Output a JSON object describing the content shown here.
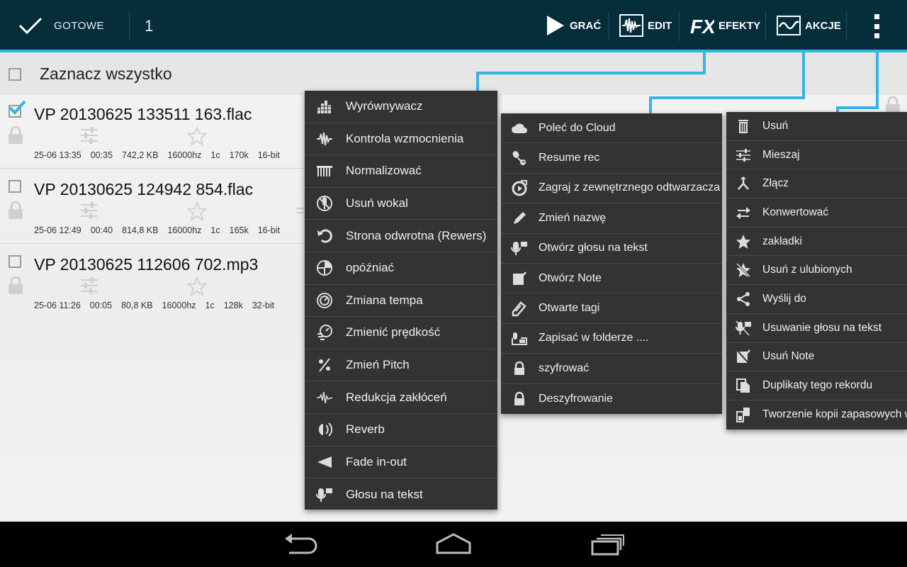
{
  "actionbar": {
    "done_label": "GOTOWE",
    "count": "1",
    "play_label": "GRAĆ",
    "edit_label": "EDIT",
    "effects_label": "EFEKTY",
    "actions_label": "AKCJE",
    "accent": "#33b5e5",
    "background": "#062d3a"
  },
  "list": {
    "select_all": "Zaznacz wszystko",
    "rows": [
      {
        "name": "VP 20130625 133511 163.flac",
        "checked": true,
        "date": "25-06 13:35",
        "duration": "00:35",
        "size": "742,2 KB",
        "rate": "16000hz",
        "channels": "1c",
        "bitrate": "170k",
        "depth": "16-bit"
      },
      {
        "name": "VP 20130625 124942 854.flac",
        "checked": false,
        "date": "25-06 12:49",
        "duration": "00:40",
        "size": "814,8 KB",
        "rate": "16000hz",
        "channels": "1c",
        "bitrate": "165k",
        "depth": "16-bit"
      },
      {
        "name": "VP 20130625 112606 702.mp3",
        "checked": false,
        "date": "25-06 11:26",
        "duration": "00:05",
        "size": "80,8 KB",
        "rate": "16000hz",
        "channels": "1c",
        "bitrate": "128k",
        "depth": "32-bit"
      }
    ]
  },
  "menus": {
    "effects": [
      {
        "label": "Wyrównywacz",
        "icon": "equalizer-icon"
      },
      {
        "label": "Kontrola wzmocnienia",
        "icon": "waveform-icon"
      },
      {
        "label": "Normalizować",
        "icon": "normalize-icon"
      },
      {
        "label": "Usuń wokal",
        "icon": "remove-vocal-icon"
      },
      {
        "label": "Strona odwrotna (Rewers)",
        "icon": "undo-icon"
      },
      {
        "label": "opóźniać",
        "icon": "delay-icon"
      },
      {
        "label": "Zmiana tempa",
        "icon": "tempo-icon"
      },
      {
        "label": "Zmienić prędkość",
        "icon": "speed-icon"
      },
      {
        "label": "Zmień Pitch",
        "icon": "pitch-icon"
      },
      {
        "label": "Redukcja zakłóceń",
        "icon": "noise-reduction-icon"
      },
      {
        "label": "Reverb",
        "icon": "reverb-icon"
      },
      {
        "label": "Fade in-out",
        "icon": "fade-icon"
      },
      {
        "label": "Głosu na tekst",
        "icon": "microphone-icon"
      }
    ],
    "edit": [
      {
        "label": "Poleć do Cloud",
        "icon": "cloud-icon"
      },
      {
        "label": "Resume rec",
        "icon": "resume-rec-icon"
      },
      {
        "label": "Zagraj z zewnętrznego odtwarzacza",
        "icon": "external-player-icon"
      },
      {
        "label": "Zmień nazwę",
        "icon": "pencil-icon"
      },
      {
        "label": "Otwórz głosu na tekst",
        "icon": "microphone-icon"
      },
      {
        "label": "Otwórz Note",
        "icon": "note-icon"
      },
      {
        "label": "Otwarte tagi",
        "icon": "tag-icon"
      },
      {
        "label": "Zapisać w folderze ....",
        "icon": "folder-save-icon"
      },
      {
        "label": "szyfrować",
        "icon": "lock-icon"
      },
      {
        "label": "Deszyfrowanie",
        "icon": "unlock-icon"
      }
    ],
    "actions": [
      {
        "label": "Usuń",
        "icon": "trash-icon"
      },
      {
        "label": "Mieszaj",
        "icon": "mixer-icon"
      },
      {
        "label": "Złącz",
        "icon": "merge-icon"
      },
      {
        "label": "Konwertować",
        "icon": "convert-icon"
      },
      {
        "label": "zakładki",
        "icon": "star-icon"
      },
      {
        "label": "Usuń z ulubionych",
        "icon": "star-remove-icon"
      },
      {
        "label": "Wyślij do",
        "icon": "share-icon"
      },
      {
        "label": "Usuwanie głosu na tekst",
        "icon": "microphone-remove-icon"
      },
      {
        "label": "Usuń Note",
        "icon": "note-remove-icon"
      },
      {
        "label": "Duplikaty tego rekordu",
        "icon": "duplicate-icon"
      },
      {
        "label": "Tworzenie kopii zapasowych w",
        "icon": "backup-icon"
      }
    ]
  }
}
